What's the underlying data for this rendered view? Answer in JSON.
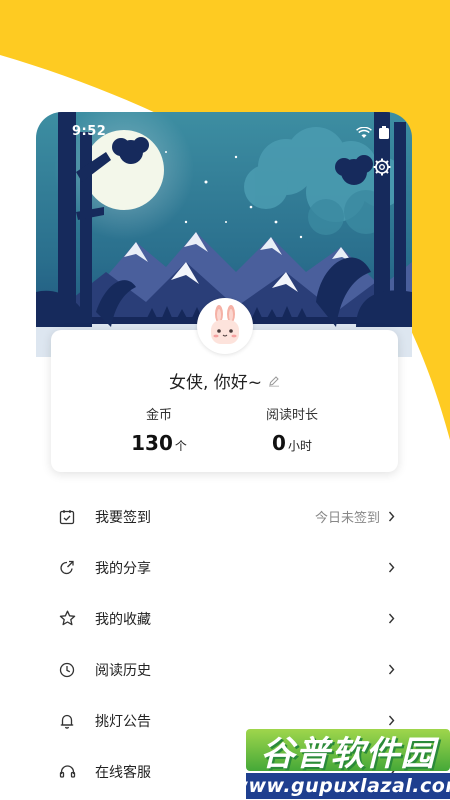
{
  "status_bar": {
    "time": "9:52"
  },
  "profile": {
    "greeting": "女侠, 你好~",
    "avatar_label": "avatar"
  },
  "stats": {
    "coins": {
      "label": "金币",
      "value": "130",
      "unit": "个"
    },
    "reading_time": {
      "label": "阅读时长",
      "value": "0",
      "unit": "小时"
    }
  },
  "menu": {
    "items": [
      {
        "label": "我要签到",
        "status": "今日未签到",
        "icon": "calendar-check-icon"
      },
      {
        "label": "我的分享",
        "status": "",
        "icon": "share-icon"
      },
      {
        "label": "我的收藏",
        "status": "",
        "icon": "star-icon"
      },
      {
        "label": "阅读历史",
        "status": "",
        "icon": "clock-icon"
      },
      {
        "label": "挑灯公告",
        "status": "",
        "icon": "bell-icon"
      },
      {
        "label": "在线客服",
        "status": "",
        "icon": "headset-icon"
      }
    ]
  },
  "watermark": {
    "title": "谷普软件园",
    "subtitle": "www.gupuxlazal.com"
  },
  "colors": {
    "accent_yellow": "#fecb22",
    "card_bg": "#ffffff",
    "sky_dark": "#0f2a5a",
    "sky_teal": "#3e8fa2"
  }
}
